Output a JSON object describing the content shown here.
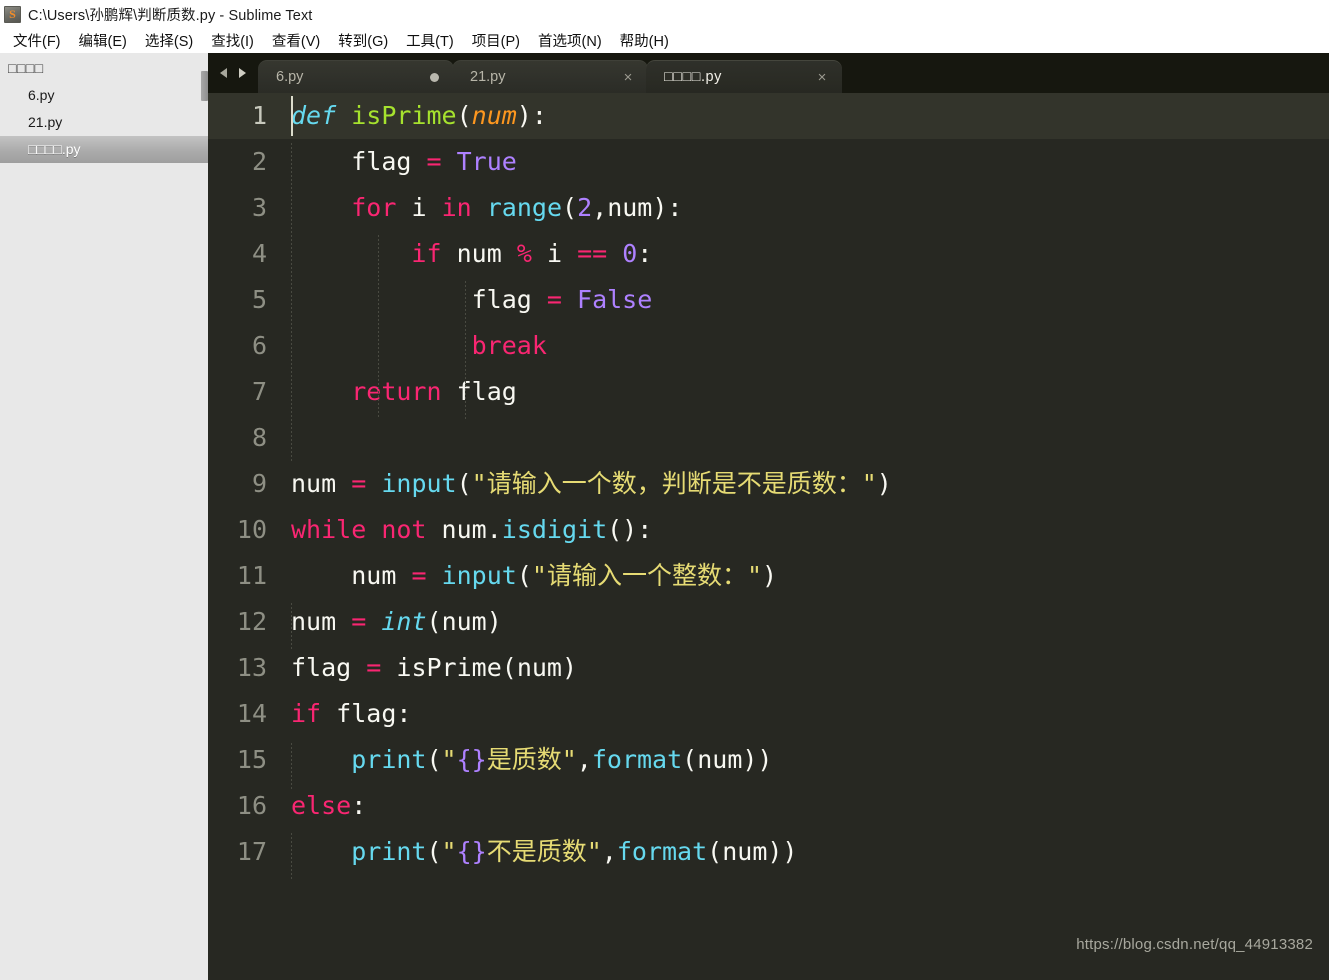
{
  "window": {
    "title": "C:\\Users\\孙鹏辉\\判断质数.py - Sublime Text",
    "icon": "sublime-text-icon",
    "icon_glyph": "S"
  },
  "menubar": {
    "items": [
      {
        "label": "文件(F)"
      },
      {
        "label": "编辑(E)"
      },
      {
        "label": "选择(S)"
      },
      {
        "label": "查找(I)"
      },
      {
        "label": "查看(V)"
      },
      {
        "label": "转到(G)"
      },
      {
        "label": "工具(T)"
      },
      {
        "label": "项目(P)"
      },
      {
        "label": "首选项(N)"
      },
      {
        "label": "帮助(H)"
      }
    ]
  },
  "sidebar": {
    "header": "□□□□",
    "files": [
      {
        "label": "6.py",
        "selected": false
      },
      {
        "label": "21.py",
        "selected": false
      },
      {
        "label": "□□□□.py",
        "selected": true
      }
    ]
  },
  "tabs": [
    {
      "label": "6.py",
      "active": false,
      "modified": true,
      "close": "×"
    },
    {
      "label": "21.py",
      "active": false,
      "modified": false,
      "close": "×"
    },
    {
      "label": "□□□□.py",
      "active": true,
      "modified": false,
      "close": "×"
    }
  ],
  "editor": {
    "language": "Python",
    "theme": "Monokai",
    "current_line": 1,
    "colors": {
      "background": "#272822",
      "foreground": "#f8f8f2",
      "keyword": "#f92672",
      "function": "#a6e22e",
      "builtin": "#66d9ef",
      "number": "#ae81ff",
      "string": "#e6db74",
      "parameter": "#fd971f",
      "gutter": "#8e8f84",
      "current_line_bg": "#33342b",
      "tabbar": "#16170f",
      "sidebar": "#e8e8e8",
      "sidebar_selected": "#ababab"
    },
    "lines": [
      {
        "n": "1",
        "code": "def isPrime(num):"
      },
      {
        "n": "2",
        "code": "    flag = True"
      },
      {
        "n": "3",
        "code": "    for i in range(2,num):"
      },
      {
        "n": "4",
        "code": "        if num % i == 0:"
      },
      {
        "n": "5",
        "code": "            flag = False"
      },
      {
        "n": "6",
        "code": "            break"
      },
      {
        "n": "7",
        "code": "    return flag"
      },
      {
        "n": "8",
        "code": ""
      },
      {
        "n": "9",
        "code": "num = input(\"请输入一个数，判断是不是质数：\")"
      },
      {
        "n": "10",
        "code": "while not num.isdigit():"
      },
      {
        "n": "11",
        "code": "    num = input(\"请输入一个整数：\")"
      },
      {
        "n": "12",
        "code": "num = int(num)"
      },
      {
        "n": "13",
        "code": "flag = isPrime(num)"
      },
      {
        "n": "14",
        "code": "if flag:"
      },
      {
        "n": "15",
        "code": "    print(\"{}是质数\",format(num))"
      },
      {
        "n": "16",
        "code": "else:"
      },
      {
        "n": "17",
        "code": "    print(\"{}不是质数\",format(num))"
      }
    ]
  },
  "watermark": "https://blog.csdn.net/qq_44913382"
}
